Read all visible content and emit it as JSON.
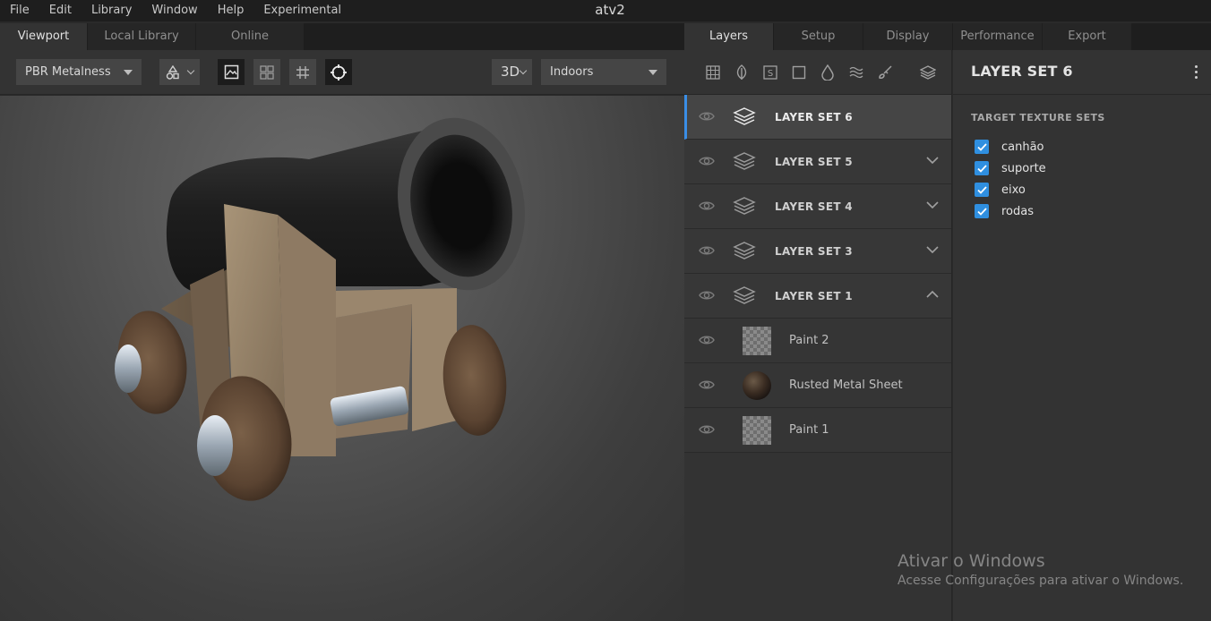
{
  "app": {
    "title": "atv2"
  },
  "menu": [
    "File",
    "Edit",
    "Library",
    "Window",
    "Help",
    "Experimental"
  ],
  "left_tabs": [
    "Viewport",
    "Local Library",
    "Online"
  ],
  "viewport_toolbar": {
    "shader_mode": "PBR Metalness",
    "view_mode": "3D",
    "environment": "Indoors"
  },
  "right_tabs": [
    "Layers",
    "Setup",
    "Display",
    "Performance",
    "Export"
  ],
  "layers": [
    {
      "name": "LAYER SET 6",
      "expanded": null
    },
    {
      "name": "LAYER SET 5",
      "expanded": false
    },
    {
      "name": "LAYER SET 4",
      "expanded": false
    },
    {
      "name": "LAYER SET 3",
      "expanded": false
    },
    {
      "name": "LAYER SET 1",
      "expanded": true
    },
    {
      "name": "Paint 2",
      "thumb": "transparent"
    },
    {
      "name": "Rusted Metal Sheet",
      "thumb": "material"
    },
    {
      "name": "Paint 1",
      "thumb": "transparent"
    }
  ],
  "properties": {
    "title": "LAYER SET 6",
    "section": "TARGET TEXTURE SETS",
    "texture_sets": [
      {
        "label": "canhão",
        "checked": true
      },
      {
        "label": "suporte",
        "checked": true
      },
      {
        "label": "eixo",
        "checked": true
      },
      {
        "label": "rodas",
        "checked": true
      }
    ]
  },
  "watermark": {
    "line1": "Ativar o Windows",
    "line2": "Acesse Configurações para ativar o Windows."
  },
  "colors": {
    "accent": "#3a8ee6",
    "checkbox": "#2f8fe0"
  }
}
